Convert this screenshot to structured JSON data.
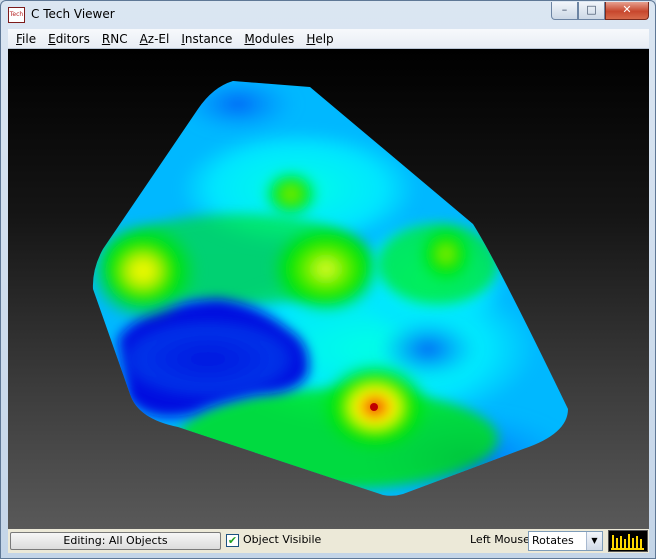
{
  "window": {
    "title": "C Tech Viewer",
    "icon_label": "Tech",
    "controls": {
      "minimize": "–",
      "maximize": "□",
      "close": "✕"
    }
  },
  "menu": {
    "items": [
      "File",
      "Editors",
      "RNC",
      "Az-El",
      "Instance",
      "Modules",
      "Help"
    ]
  },
  "viewport": {
    "colors": {
      "low": "#0000e6",
      "mid_low": "#00b4ff",
      "mid": "#00ffea",
      "mid_high": "#00e600",
      "high": "#ffff00",
      "peak": "#e00000"
    }
  },
  "statusbar": {
    "editing_label": "Editing: All Objects",
    "object_visible_checked": true,
    "object_visible_label": "Object Visibile",
    "left_mouse_label": "Left Mouse",
    "left_mouse_value": "Rotates"
  }
}
